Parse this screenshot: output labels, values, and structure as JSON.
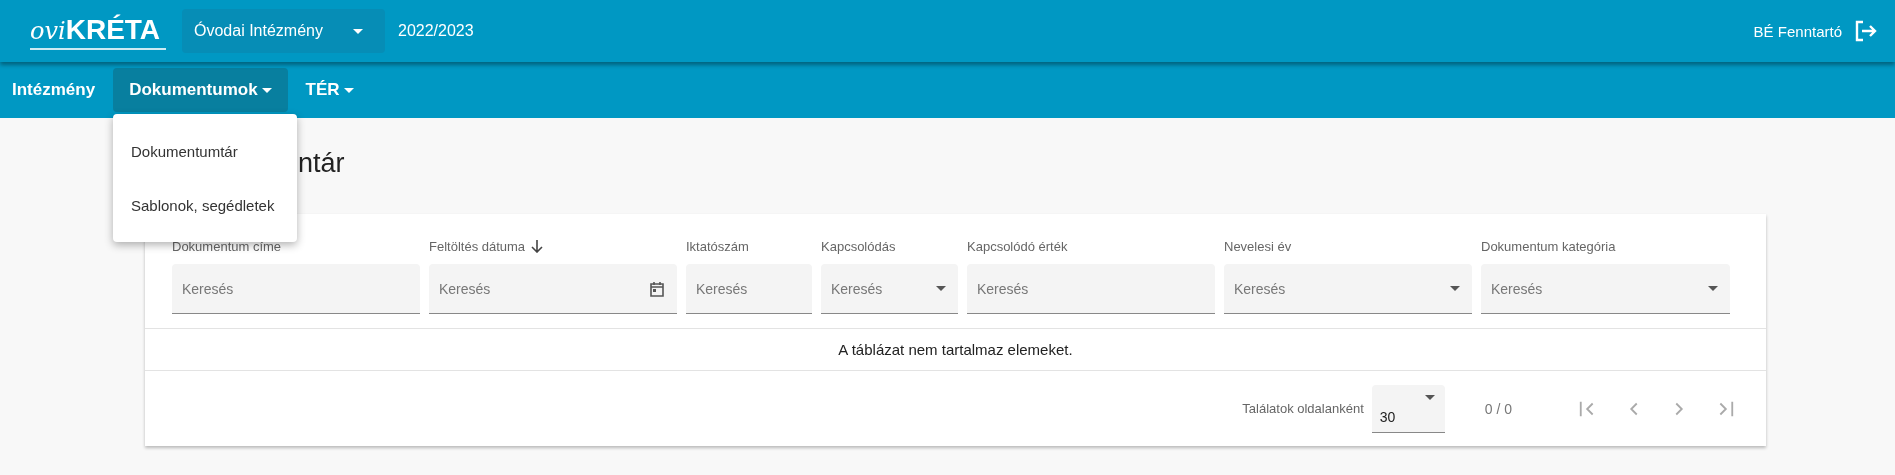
{
  "header": {
    "logo": {
      "script": "ovi",
      "word": "KRÉTA"
    },
    "institution_select": {
      "value": "Óvodai Intézmény"
    },
    "school_year": "2022/2023",
    "user": "BÉ Fenntartó"
  },
  "nav": [
    {
      "label": "Intézmény",
      "selected": false,
      "dropdown": false
    },
    {
      "label": "Dokumentumok",
      "selected": true,
      "dropdown": true
    },
    {
      "label": "TÉR",
      "selected": false,
      "dropdown": true
    }
  ],
  "menu": {
    "items": [
      "Dokumentumtár",
      "Sablonok, segédletek"
    ]
  },
  "page_title": "ntár",
  "table": {
    "columns": [
      {
        "label": "Dokumentum címe",
        "placeholder": "Keresés",
        "kind": "text",
        "sort_descending": false
      },
      {
        "label": "Feltöltés dátuma",
        "placeholder": "Keresés",
        "kind": "date",
        "sort_descending": true
      },
      {
        "label": "Iktatószám",
        "placeholder": "Keresés",
        "kind": "text",
        "sort_descending": false
      },
      {
        "label": "Kapcsolódás",
        "placeholder": "Keresés",
        "kind": "select",
        "sort_descending": false
      },
      {
        "label": "Kapcsolódó érték",
        "placeholder": "Keresés",
        "kind": "text",
        "sort_descending": false
      },
      {
        "label": "Nevelesi év",
        "placeholder": "Keresés",
        "kind": "select",
        "sort_descending": false
      },
      {
        "label": "Dokumentum kategória",
        "placeholder": "Keresés",
        "kind": "select",
        "sort_descending": false
      }
    ],
    "empty_message": "A táblázat nem tartalmaz elemeket."
  },
  "paginator": {
    "page_size_label": "Találatok oldalanként",
    "page_size": "30",
    "range": "0 / 0",
    "buttons": [
      {
        "kind": "first",
        "disabled": true
      },
      {
        "kind": "previous",
        "disabled": true
      },
      {
        "kind": "next",
        "disabled": true
      },
      {
        "kind": "last",
        "disabled": true
      }
    ]
  }
}
